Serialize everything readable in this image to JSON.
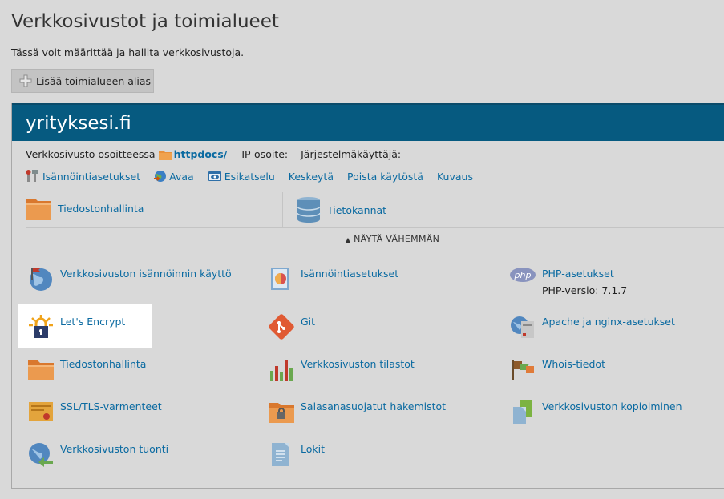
{
  "page": {
    "title": "Verkkosivustot ja toimialueet",
    "description": "Tässä voit määrittää ja hallita verkkosivustoja.",
    "add_alias_label": "Lisää toimialueen alias"
  },
  "domain": {
    "name": "yrityksesi.fi",
    "info": {
      "site_at_label": "Verkkosivusto osoitteessa",
      "folder_link": "httpdocs/",
      "ip_label": "IP-osoite:",
      "system_user_label": "Järjestelmäkäyttäjä:"
    },
    "actions": [
      {
        "label": "Isännöintiasetukset",
        "icon": "wrench-icon"
      },
      {
        "label": "Avaa",
        "icon": "globe-open-icon"
      },
      {
        "label": "Esikatselu",
        "icon": "preview-eye-icon"
      },
      {
        "label": "Keskeytä"
      },
      {
        "label": "Poista käytöstä"
      },
      {
        "label": "Kuvaus"
      }
    ],
    "quick": [
      {
        "label": "Tiedostonhallinta",
        "icon": "folder-icon"
      },
      {
        "label": "Tietokannat",
        "icon": "database-icon"
      }
    ],
    "toggle_label": "NÄYTÄ VÄHEMMÄN",
    "tools": {
      "hosting_usage": {
        "label": "Verkkosivuston isännöinnin käyttö",
        "icon": "globe-flag-icon"
      },
      "hosting_settings": {
        "label": "Isännöintiasetukset",
        "icon": "hosting-settings-icon"
      },
      "php_settings": {
        "label": "PHP-asetukset",
        "sub": "PHP-versio: 7.1.7",
        "icon": "php-icon"
      },
      "lets_encrypt": {
        "label": "Let's Encrypt",
        "icon": "lets-encrypt-icon"
      },
      "git": {
        "label": "Git",
        "icon": "git-icon"
      },
      "apache_nginx": {
        "label": "Apache ja nginx-asetukset",
        "icon": "apache-nginx-icon"
      },
      "file_manager": {
        "label": "Tiedostonhallinta",
        "icon": "folder-icon"
      },
      "statistics": {
        "label": "Verkkosivuston tilastot",
        "icon": "bar-chart-icon"
      },
      "whois": {
        "label": "Whois-tiedot",
        "icon": "whois-flags-icon"
      },
      "ssl": {
        "label": "SSL/TLS-varmenteet",
        "icon": "certificate-icon"
      },
      "protected_dirs": {
        "label": "Salasanasuojatut hakemistot",
        "icon": "locked-folder-icon"
      },
      "copy_site": {
        "label": "Verkkosivuston kopioiminen",
        "icon": "copy-docs-icon"
      },
      "import_site": {
        "label": "Verkkosivuston tuonti",
        "icon": "globe-import-icon"
      },
      "logs": {
        "label": "Lokit",
        "icon": "log-file-icon"
      }
    }
  },
  "colors": {
    "header_bg": "#065a80",
    "link": "#0a6aa1",
    "page_bg": "#d9d9d9"
  }
}
